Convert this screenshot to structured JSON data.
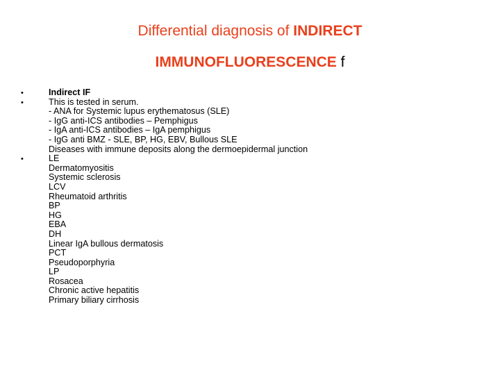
{
  "title": {
    "line1_prefix": "Differential diagnosis of ",
    "line1_bold": "INDIRECT",
    "line2_bold": "IMMUNOFLUORESCENCE",
    "line2_suffix": " f",
    "accent_color": "#e8401c"
  },
  "bullets": [
    {
      "lines": [
        "Indirect IF"
      ],
      "bold": true
    },
    {
      "lines": [
        "This is tested in serum.",
        "- ANA for Systemic lupus erythematosus (SLE)",
        "- IgG anti-ICS antibodies – Pemphigus",
        "- IgA anti-ICS antibodies – IgA pemphigus",
        "- IgG anti BMZ - SLE, BP, HG, EBV, Bullous SLE",
        "Diseases with immune deposits along the dermoepidermal junction"
      ],
      "bold": false
    },
    {
      "lines": [
        "LE",
        "Dermatomyositis",
        "Systemic sclerosis",
        "LCV",
        "Rheumatoid arthritis",
        "BP",
        "HG",
        "EBA",
        "DH",
        "Linear IgA bullous dermatosis",
        "PCT",
        "Pseudoporphyria",
        "LP",
        "Rosacea",
        "Chronic active hepatitis",
        "Primary biliary cirrhosis"
      ],
      "bold": false
    }
  ]
}
